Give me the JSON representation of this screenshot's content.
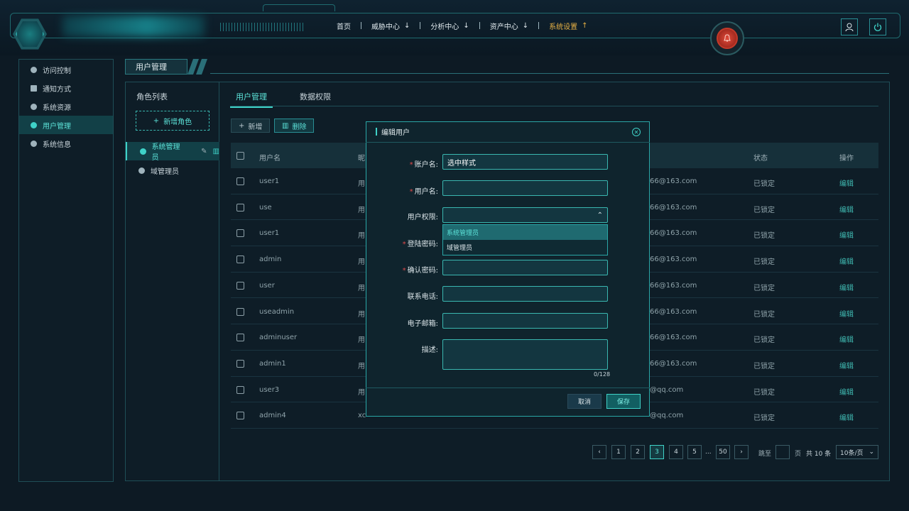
{
  "nav": {
    "items": [
      {
        "label": "首页",
        "arrow": ""
      },
      {
        "label": "威胁中心",
        "arrow": "↓"
      },
      {
        "label": "分析中心",
        "arrow": "↓"
      },
      {
        "label": "资产中心",
        "arrow": "↓"
      },
      {
        "label": "系统设置",
        "arrow": "↑"
      }
    ]
  },
  "sidebar": {
    "items": [
      {
        "label": "访问控制"
      },
      {
        "label": "通知方式"
      },
      {
        "label": "系统资源"
      },
      {
        "label": "用户管理"
      },
      {
        "label": "系统信息"
      }
    ]
  },
  "page": {
    "title": "用户管理"
  },
  "roles": {
    "title": "角色列表",
    "add_label": "新增角色",
    "items": [
      {
        "label": "系统管理员"
      },
      {
        "label": "域管理员"
      }
    ]
  },
  "tabs": [
    {
      "label": "用户管理"
    },
    {
      "label": "数据权限"
    }
  ],
  "toolbar": {
    "add": "新增",
    "delete": "删除"
  },
  "table": {
    "headers": {
      "username": "用户名",
      "nickname": "昵",
      "status": "状态",
      "action": "操作"
    },
    "rows": [
      {
        "username": "user1",
        "nick": "用",
        "email": "66@163.com",
        "status": "已锁定",
        "action": "编辑"
      },
      {
        "username": "use",
        "nick": "用",
        "email": "66@163.com",
        "status": "已锁定",
        "action": "编辑"
      },
      {
        "username": "user1",
        "nick": "用",
        "email": "66@163.com",
        "status": "已锁定",
        "action": "编辑"
      },
      {
        "username": "admin",
        "nick": "用",
        "email": "66@163.com",
        "status": "已锁定",
        "action": "编辑"
      },
      {
        "username": "user",
        "nick": "用",
        "email": "66@163.com",
        "status": "已锁定",
        "action": "编辑"
      },
      {
        "username": "useadmin",
        "nick": "用",
        "email": "66@163.com",
        "status": "已锁定",
        "action": "编辑"
      },
      {
        "username": "adminuser",
        "nick": "用",
        "email": "66@163.com",
        "status": "已锁定",
        "action": "编辑"
      },
      {
        "username": "admin1",
        "nick": "用",
        "email": "66@163.com",
        "status": "已锁定",
        "action": "编辑"
      },
      {
        "username": "user3",
        "nick": "用",
        "email": "@qq.com",
        "status": "已锁定",
        "action": "编辑"
      },
      {
        "username": "admin4",
        "nick": "xc",
        "email": "@qq.com",
        "status": "已锁定",
        "action": "编辑"
      }
    ]
  },
  "pagination": {
    "pages": [
      "1",
      "2",
      "3",
      "4",
      "5",
      "...",
      "50"
    ],
    "current": "3",
    "jump_label": "跳至",
    "page_unit": "页",
    "total": "共 10 条",
    "page_size": "10条/页"
  },
  "modal": {
    "title": "编辑用户",
    "fields": {
      "account": {
        "label": "账户名:",
        "value": "选中样式",
        "required": "*"
      },
      "username": {
        "label": "用户名:",
        "value": "",
        "required": "*"
      },
      "permission": {
        "label": "用户权限:",
        "value": ""
      },
      "password": {
        "label": "登陆密码:",
        "value": "",
        "required": "*"
      },
      "confirm": {
        "label": "确认密码:",
        "value": "",
        "required": "*"
      },
      "phone": {
        "label": "联系电话:",
        "value": ""
      },
      "email": {
        "label": "电子邮箱:",
        "value": ""
      },
      "desc": {
        "label": "描述:",
        "value": "",
        "counter": "0/128"
      }
    },
    "dropdown_options": [
      "系统管理员",
      "域管理员"
    ],
    "cancel": "取消",
    "save": "保存"
  },
  "colors": {
    "accent": "#3fd2c8",
    "nav_active": "#e6b044",
    "alarm": "#e04a3a",
    "danger": "#e04a4a"
  }
}
